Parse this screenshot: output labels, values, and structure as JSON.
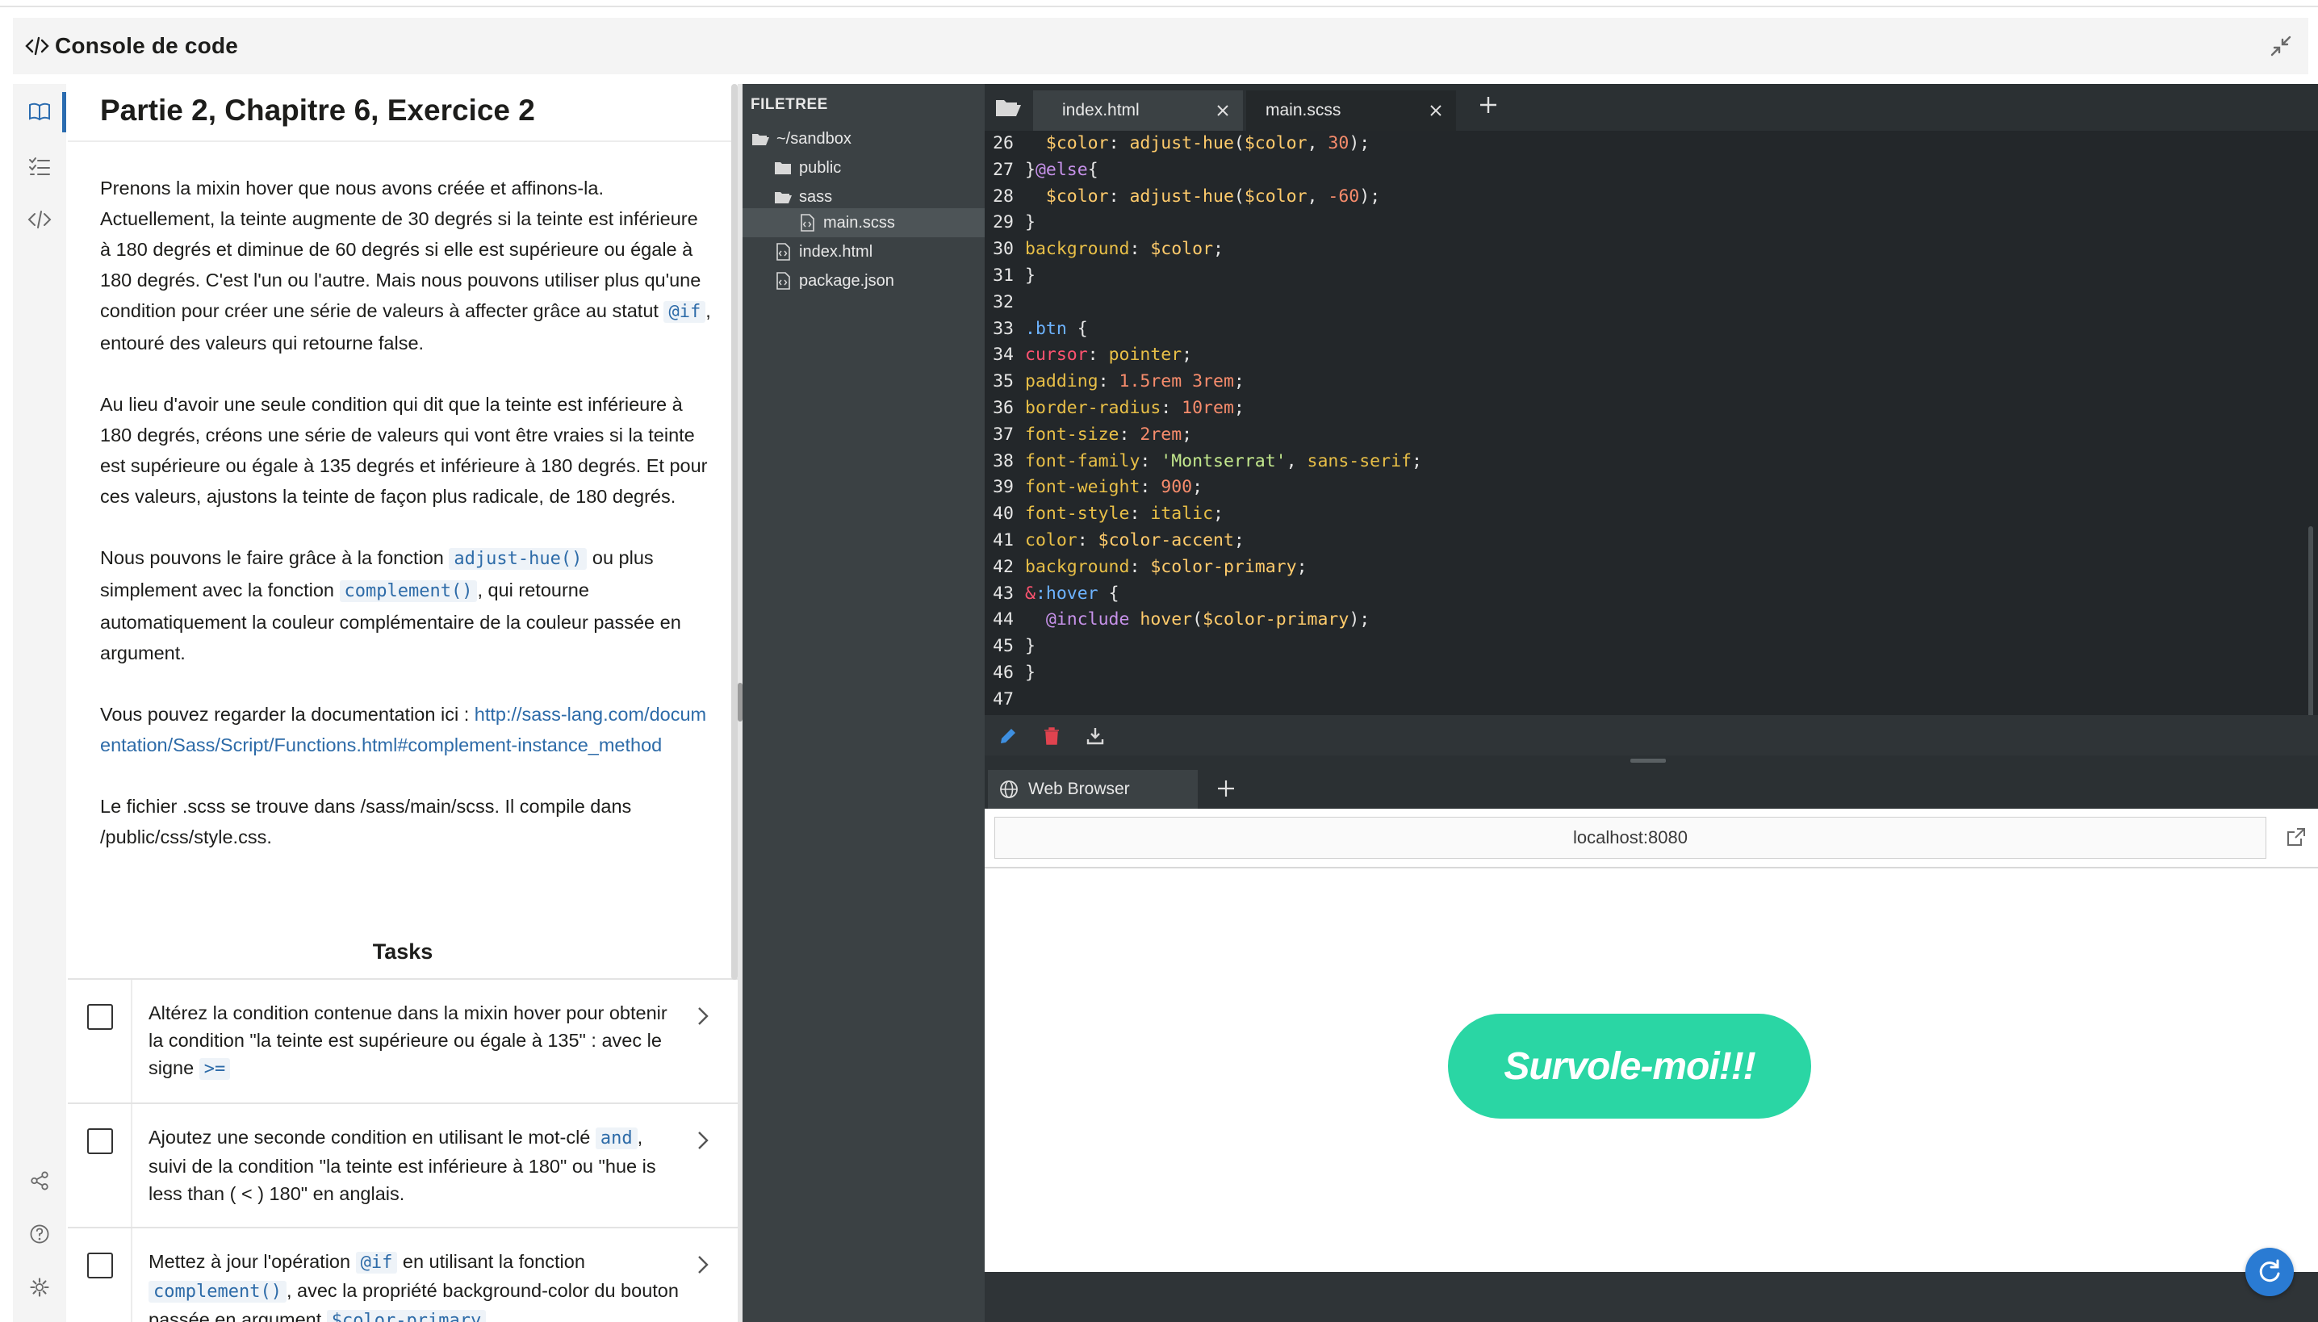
{
  "header": {
    "title": "Console de code"
  },
  "exercise": {
    "title": "Partie 2, Chapitre 6, Exercice 2",
    "p1_a": "Prenons la mixin hover que nous avons créée et affinons-la. Actuellement, la teinte augmente de 30 degrés si la teinte est inférieure à 180 degrés et diminue de 60 degrés si elle est supérieure ou égale à 180 degrés. C'est l'un ou l'autre. Mais nous pouvons utiliser plus qu'une condition pour créer une série de valeurs à affecter grâce au statut ",
    "p1_code": "@if",
    "p1_b": ", entouré des valeurs qui retourne false.",
    "p2": "Au lieu d'avoir une seule condition qui dit que la teinte est inférieure à 180 degrés, créons une série de valeurs qui vont être vraies si la teinte est supérieure ou égale à 135 degrés et inférieure à 180 degrés. Et pour ces valeurs, ajustons la teinte de façon plus radicale, de 180 degrés.",
    "p3_a": "Nous pouvons le faire grâce à la fonction ",
    "p3_code1": "adjust-hue()",
    "p3_b": " ou plus simplement avec la fonction ",
    "p3_code2": "complement()",
    "p3_c": ", qui retourne automatiquement la couleur complémentaire de la couleur passée en argument.",
    "p4_a": "Vous pouvez regarder la documentation ici : ",
    "p4_link": "http://sass-lang.com/documentation/Sass/Script/Functions.html#complement-instance_method",
    "p5": "Le fichier .scss se trouve dans /sass/main/scss. Il compile dans /public/css/style.css."
  },
  "tasks": {
    "heading": "Tasks",
    "t1_a": "Altérez la condition contenue dans la mixin hover pour obtenir la condition \"la teinte est supérieure ou égale à 135\" : avec le signe ",
    "t1_code": ">=",
    "t2_a": "Ajoutez une seconde condition en utilisant le mot-clé ",
    "t2_code": "and",
    "t2_b": ", suivi de la condition \"la teinte est inférieure à 180\" ou \"hue is less than ( < ) 180\" en anglais.",
    "t3_a": "Mettez à jour l'opération ",
    "t3_code1": "@if",
    "t3_b": " en utilisant la fonction ",
    "t3_code2": "complement()",
    "t3_c": ", avec la propriété background-color du bouton passée en argument ",
    "t3_code3": "$color-primary"
  },
  "filetree": {
    "heading": "FILETREE",
    "root": "~/sandbox",
    "public": "public",
    "sass": "sass",
    "main": "main.scss",
    "index": "index.html",
    "pkg": "package.json"
  },
  "editor_tabs": {
    "tab1": "index.html",
    "tab2": "main.scss"
  },
  "code_lines": [
    {
      "n": "26"
    },
    {
      "n": "27"
    },
    {
      "n": "28"
    },
    {
      "n": "29"
    },
    {
      "n": "30"
    },
    {
      "n": "31"
    },
    {
      "n": "32"
    },
    {
      "n": "33"
    },
    {
      "n": "34"
    },
    {
      "n": "35"
    },
    {
      "n": "36"
    },
    {
      "n": "37"
    },
    {
      "n": "38"
    },
    {
      "n": "39"
    },
    {
      "n": "40"
    },
    {
      "n": "41"
    },
    {
      "n": "42"
    },
    {
      "n": "43"
    },
    {
      "n": "44"
    },
    {
      "n": "45"
    },
    {
      "n": "46"
    },
    {
      "n": "47"
    }
  ],
  "browser": {
    "tab_label": "Web Browser",
    "url": "localhost:8080",
    "demo_button": "Survole-moi!!!"
  },
  "colors": {
    "accent": "#2ad6a4",
    "link": "#2d6ba8",
    "ide_bg": "#23272a"
  },
  "icons": [
    "code-icon",
    "collapse-icon",
    "book-icon",
    "tasklist-icon",
    "share-icon",
    "help-icon",
    "settings-icon",
    "folder-icon",
    "file-code-icon",
    "close-icon",
    "plus-icon",
    "pencil-icon",
    "trash-icon",
    "download-icon",
    "globe-icon",
    "external-link-icon",
    "refresh-icon",
    "chevron-right-icon"
  ]
}
